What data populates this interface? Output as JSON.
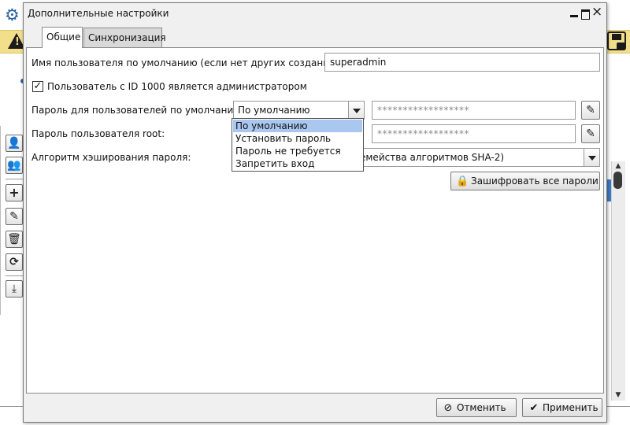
{
  "dialog": {
    "title": "Дополнительные настройки",
    "window_buttons": {
      "minimize": "minimize-icon",
      "maximize": "maximize-icon",
      "close": "×"
    }
  },
  "tabs": [
    {
      "label": "Общие",
      "active": true
    },
    {
      "label": "Синхронизация",
      "active": false
    }
  ],
  "form": {
    "default_user_label": "Имя пользователя по умолчанию (если нет других созданных):",
    "default_user_value": "superadmin",
    "admin_checkbox_label": "Пользователь с ID 1000 является администратором",
    "admin_checkbox_checked": true,
    "default_password_label": "Пароль для пользователей по умолчанию:",
    "default_password_mode": "По умолчанию",
    "default_password_masked": "******************",
    "root_password_label": "Пароль пользователя root:",
    "root_password_masked": "******************",
    "hash_algo_label": "Алгоритм хэширования пароля:",
    "hash_algo_value": "емейства алгоритмов SHA-2)",
    "encrypt_all_button": "Зашифровать все пароли"
  },
  "dropdown": {
    "options": [
      "По умолчанию",
      "Установить пароль",
      "Пароль не требуется",
      "Запретить вход"
    ],
    "selected_index": 0
  },
  "footer": {
    "cancel_label": "Отменить",
    "apply_label": "Применить"
  },
  "icons": {
    "edit": "pencil-icon",
    "lock": "lock-icon",
    "cancel": "cancel-icon",
    "apply": "checkmark-icon"
  },
  "colors": {
    "warning_strip": "#f3df8a",
    "selection": "#a9c7ef",
    "accent_blue": "#3e7bc8"
  }
}
